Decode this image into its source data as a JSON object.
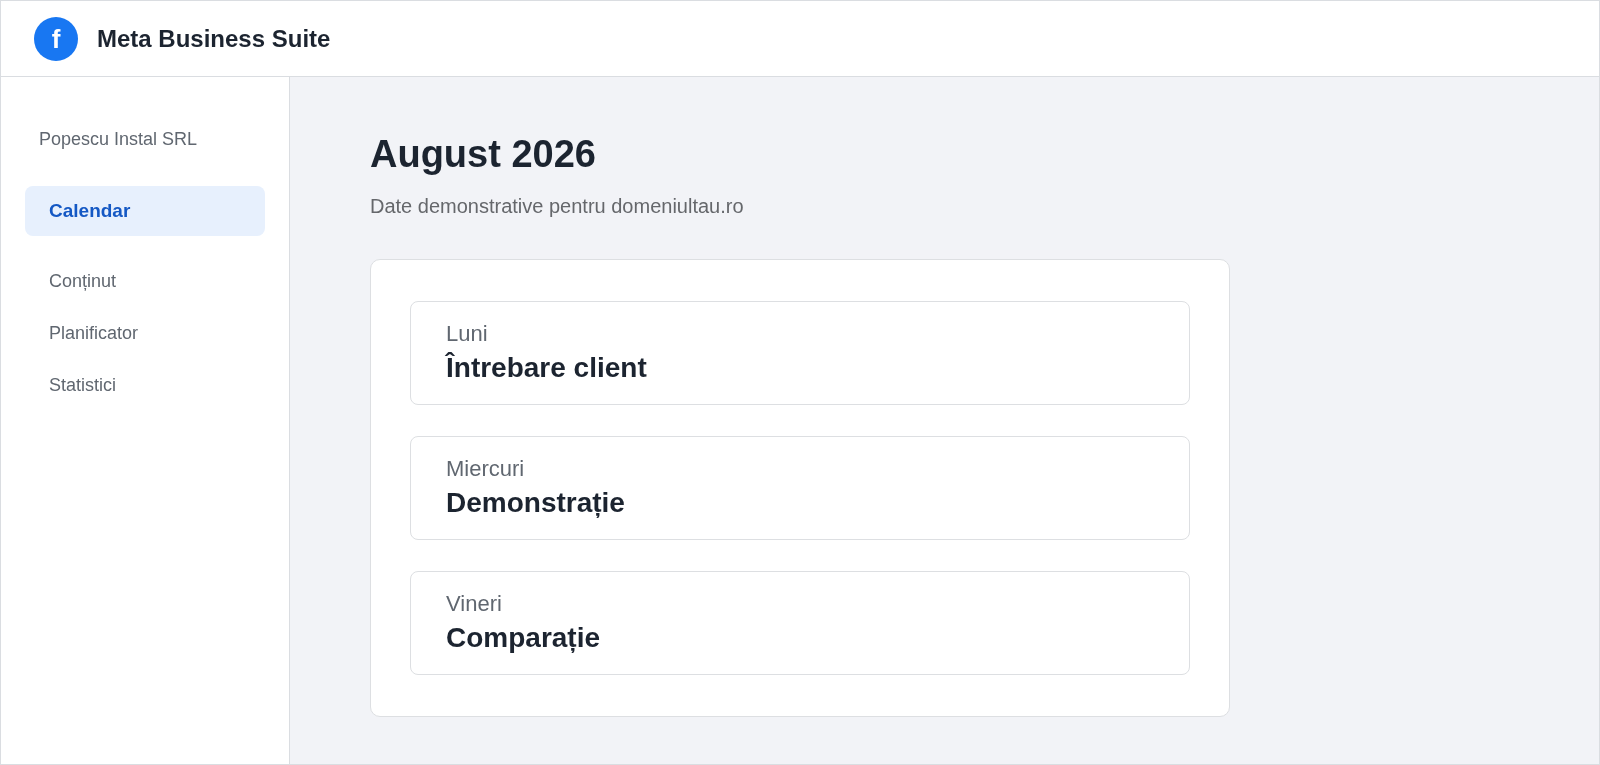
{
  "header": {
    "logo": "f",
    "title": "Meta Business Suite"
  },
  "sidebar": {
    "account": "Popescu Instal SRL",
    "items": [
      {
        "label": "Calendar",
        "selected": true
      },
      {
        "label": "Conținut",
        "selected": false
      },
      {
        "label": "Planificator",
        "selected": false
      },
      {
        "label": "Statistici",
        "selected": false
      }
    ]
  },
  "main": {
    "title": "August 2026",
    "subtitle": "Date demonstrative pentru domeniultau.ro",
    "events": [
      {
        "day": "Luni",
        "title": "Întrebare client"
      },
      {
        "day": "Miercuri",
        "title": "Demonstrație"
      },
      {
        "day": "Vineri",
        "title": "Comparație"
      }
    ]
  }
}
